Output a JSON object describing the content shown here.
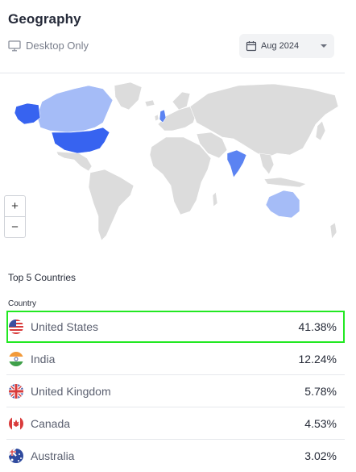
{
  "header": {
    "title": "Geography",
    "device_label": "Desktop Only",
    "date_label": "Aug 2024"
  },
  "map": {
    "colors": {
      "land": "#dcdcdc",
      "level_high": "#3763f0",
      "level_mid": "#5b83f2",
      "level_low": "#a5bcf7",
      "border": "#ffffff"
    },
    "zoom_in": "+",
    "zoom_out": "−"
  },
  "table": {
    "section_title": "Top 5 Countries",
    "column_header": "Country",
    "rows": [
      {
        "country": "United States",
        "value": "41.38%",
        "flag": "us-flag-icon"
      },
      {
        "country": "India",
        "value": "12.24%",
        "flag": "india-flag-icon"
      },
      {
        "country": "United Kingdom",
        "value": "5.78%",
        "flag": "uk-flag-icon"
      },
      {
        "country": "Canada",
        "value": "4.53%",
        "flag": "canada-flag-icon"
      },
      {
        "country": "Australia",
        "value": "3.02%",
        "flag": "australia-flag-icon"
      }
    ]
  }
}
